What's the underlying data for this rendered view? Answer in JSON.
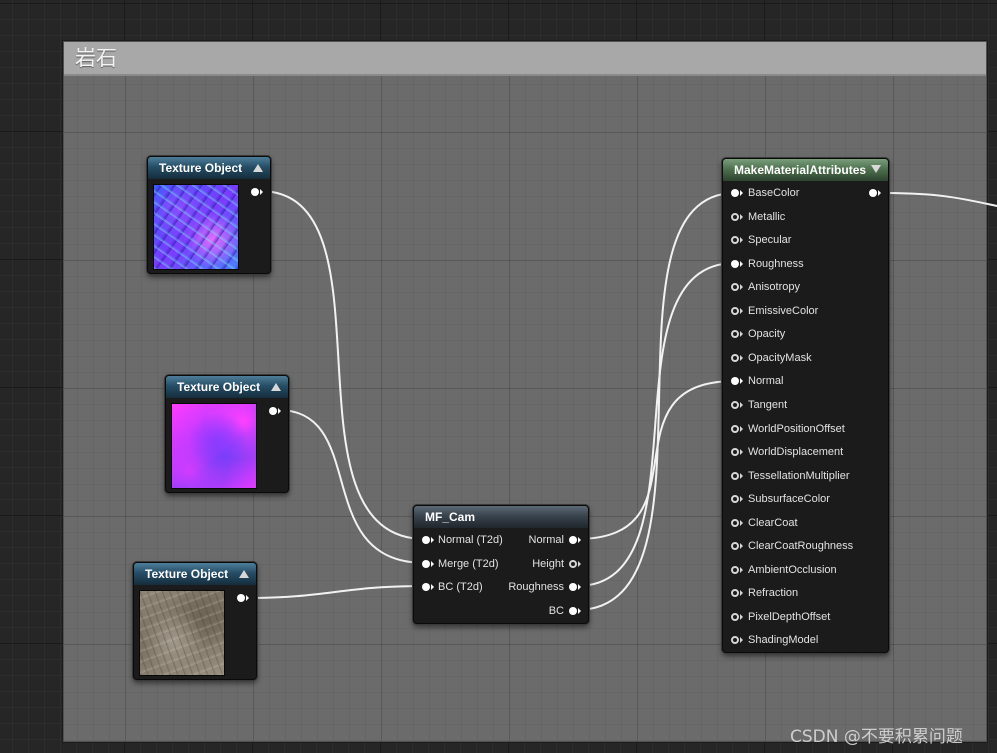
{
  "comment": {
    "title": "岩石"
  },
  "texture_nodes": [
    {
      "title": "Texture Object",
      "preview": "normal-map",
      "collapse_icon": "triangle-up-icon"
    },
    {
      "title": "Texture Object",
      "preview": "merge-mask",
      "collapse_icon": "triangle-up-icon"
    },
    {
      "title": "Texture Object",
      "preview": "base-color-rock",
      "collapse_icon": "triangle-up-icon"
    }
  ],
  "mf_cam": {
    "title": "MF_Cam",
    "inputs": [
      {
        "label": "Normal (T2d)",
        "connected": true
      },
      {
        "label": "Merge (T2d)",
        "connected": true
      },
      {
        "label": "BC (T2d)",
        "connected": true
      }
    ],
    "outputs": [
      {
        "label": "Normal",
        "connected": true
      },
      {
        "label": "Height",
        "connected": false
      },
      {
        "label": "Roughness",
        "connected": true
      },
      {
        "label": "BC",
        "connected": true
      }
    ]
  },
  "make_material": {
    "title": "MakeMaterialAttributes",
    "collapse_icon": "triangle-down-icon",
    "inputs": [
      {
        "label": "BaseColor",
        "connected": true
      },
      {
        "label": "Metallic",
        "connected": false
      },
      {
        "label": "Specular",
        "connected": false
      },
      {
        "label": "Roughness",
        "connected": true
      },
      {
        "label": "Anisotropy",
        "connected": false
      },
      {
        "label": "EmissiveColor",
        "connected": false
      },
      {
        "label": "Opacity",
        "connected": false
      },
      {
        "label": "OpacityMask",
        "connected": false
      },
      {
        "label": "Normal",
        "connected": true
      },
      {
        "label": "Tangent",
        "connected": false
      },
      {
        "label": "WorldPositionOffset",
        "connected": false
      },
      {
        "label": "WorldDisplacement",
        "connected": false
      },
      {
        "label": "TessellationMultiplier",
        "connected": false
      },
      {
        "label": "SubsurfaceColor",
        "connected": false
      },
      {
        "label": "ClearCoat",
        "connected": false
      },
      {
        "label": "ClearCoatRoughness",
        "connected": false
      },
      {
        "label": "AmbientOcclusion",
        "connected": false
      },
      {
        "label": "Refraction",
        "connected": false
      },
      {
        "label": "PixelDepthOffset",
        "connected": false
      },
      {
        "label": "ShadingModel",
        "connected": false
      }
    ],
    "output": {
      "connected": true
    }
  },
  "colors": {
    "canvas_bg": "#262626",
    "comment_bg": "#6b6b6b",
    "comment_title_bg": "#a8a8a8",
    "node_bg": "#1b1b1b",
    "texture_header": "#264d66",
    "function_header": "#38434c",
    "make_header": "#4e714f",
    "wire": "#ffffff"
  },
  "watermark": {
    "text": "CSDN @不要积累问题"
  }
}
